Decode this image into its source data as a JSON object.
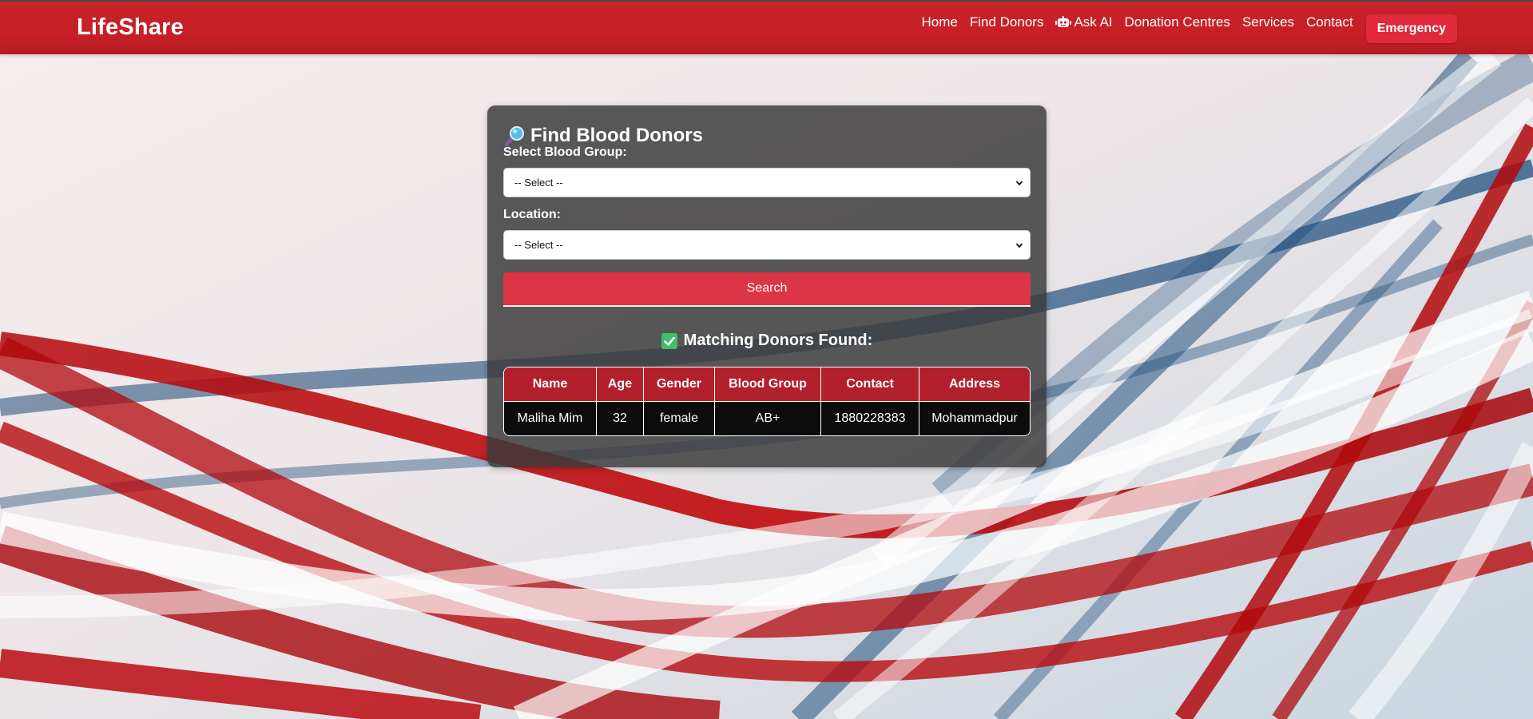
{
  "navbar": {
    "brand": "LifeShare",
    "links": {
      "home": "Home",
      "find_donors": "Find Donors",
      "ask_ai": "Ask AI",
      "donation_centres": "Donation Centres",
      "services": "Services",
      "contact": "Contact"
    },
    "emergency_label": "Emergency",
    "icons": {
      "ask_ai": "robot-icon"
    }
  },
  "search_card": {
    "title": "Find Blood Donors",
    "title_icon": "magnifier-icon",
    "blood_group": {
      "label": "Select Blood Group:",
      "selected": "-- Select --"
    },
    "location": {
      "label": "Location:",
      "selected": "-- Select --"
    },
    "search_label": "Search"
  },
  "results": {
    "title": "Matching Donors Found:",
    "title_icon": "check-icon",
    "columns": [
      "Name",
      "Age",
      "Gender",
      "Blood Group",
      "Contact",
      "Address"
    ],
    "rows": [
      [
        "Maliha Mim",
        "32",
        "female",
        "AB+",
        "1880228383",
        "Mohammadpur"
      ]
    ]
  },
  "colors": {
    "navbar": "#c6232a",
    "emergency_button": "#e02a3b",
    "search_button": "#dc3545",
    "table_header": "#b3202c",
    "card_bg": "#3a3a3a"
  }
}
